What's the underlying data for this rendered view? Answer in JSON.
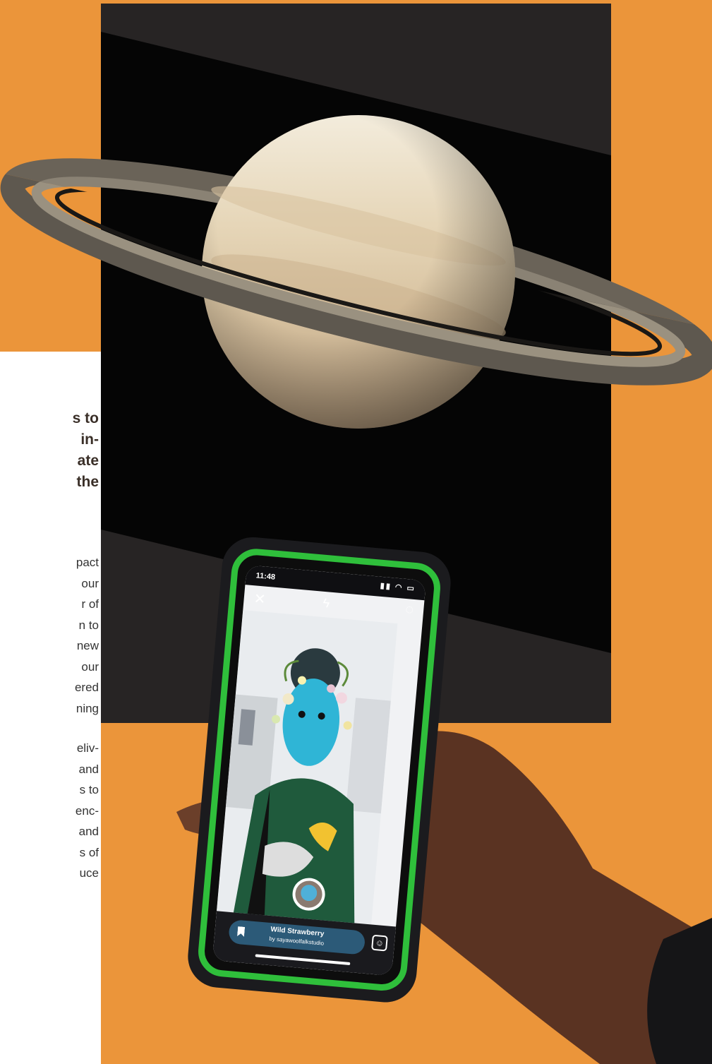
{
  "page": {
    "background_accent": "#EB953A",
    "headline": "s to\nin-\nate\nthe",
    "paragraph_1": "pact\nour\nr of\nn to\nnew\nour\nered\nning",
    "paragraph_2": "eliv-\nand\ns to\nenc-\nand\ns of\nuce"
  },
  "phone": {
    "status_time": "11:48",
    "status_icons": "signal wifi battery",
    "controls": {
      "close_icon": "close-icon",
      "flash_icon": "flash-off-icon",
      "flip_icon": "flip-camera-icon"
    },
    "effect": {
      "name": "Wild Strawberry",
      "author": "by sayawoolfalkstudio"
    },
    "case_color": "#2fbf3b"
  }
}
